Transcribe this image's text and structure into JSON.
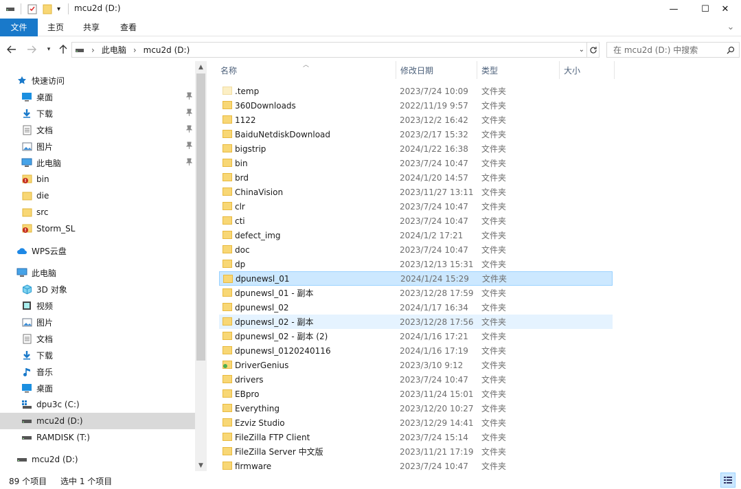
{
  "window": {
    "title": "mcu2d (D:)",
    "minimize": "—",
    "maximize": "☐",
    "close": "✕"
  },
  "ribbon": {
    "tabs": [
      "文件",
      "主页",
      "共享",
      "查看"
    ],
    "expand": "⌄"
  },
  "address": {
    "crumbs": [
      "此电脑",
      "mcu2d (D:)"
    ],
    "separator": "›"
  },
  "search": {
    "placeholder": "在 mcu2d (D:) 中搜索"
  },
  "nav": {
    "quick_access": "快速访问",
    "items": [
      {
        "label": "快速访问",
        "icon": "star-icon",
        "indent": 1,
        "pinned": false,
        "selected": false
      },
      {
        "label": "桌面",
        "icon": "desktop-icon",
        "indent": 2,
        "pinned": true,
        "selected": false
      },
      {
        "label": "下载",
        "icon": "download-icon",
        "indent": 2,
        "pinned": true,
        "selected": false
      },
      {
        "label": "文档",
        "icon": "document-icon",
        "indent": 2,
        "pinned": true,
        "selected": false
      },
      {
        "label": "图片",
        "icon": "pictures-icon",
        "indent": 2,
        "pinned": true,
        "selected": false
      },
      {
        "label": "此电脑",
        "icon": "pc-icon",
        "indent": 2,
        "pinned": true,
        "selected": false
      },
      {
        "label": "bin",
        "icon": "folder-warning-icon",
        "indent": 2,
        "pinned": false,
        "selected": false
      },
      {
        "label": "die",
        "icon": "folder-icon",
        "indent": 2,
        "pinned": false,
        "selected": false
      },
      {
        "label": "src",
        "icon": "folder-icon",
        "indent": 2,
        "pinned": false,
        "selected": false
      },
      {
        "label": "Storm_SL",
        "icon": "folder-warning-icon",
        "indent": 2,
        "pinned": false,
        "selected": false
      },
      {
        "label": "",
        "icon": "",
        "indent": 0,
        "pinned": false,
        "selected": false
      },
      {
        "label": "WPS云盘",
        "icon": "cloud-icon",
        "indent": 1,
        "pinned": false,
        "selected": false
      },
      {
        "label": "",
        "icon": "",
        "indent": 0,
        "pinned": false,
        "selected": false
      },
      {
        "label": "此电脑",
        "icon": "pc-icon",
        "indent": 1,
        "pinned": false,
        "selected": false
      },
      {
        "label": "3D 对象",
        "icon": "cube-icon",
        "indent": 2,
        "pinned": false,
        "selected": false
      },
      {
        "label": "视频",
        "icon": "video-icon",
        "indent": 2,
        "pinned": false,
        "selected": false
      },
      {
        "label": "图片",
        "icon": "pictures-icon",
        "indent": 2,
        "pinned": false,
        "selected": false
      },
      {
        "label": "文档",
        "icon": "document-icon",
        "indent": 2,
        "pinned": false,
        "selected": false
      },
      {
        "label": "下载",
        "icon": "download-icon",
        "indent": 2,
        "pinned": false,
        "selected": false
      },
      {
        "label": "音乐",
        "icon": "music-icon",
        "indent": 2,
        "pinned": false,
        "selected": false
      },
      {
        "label": "桌面",
        "icon": "desktop-icon",
        "indent": 2,
        "pinned": false,
        "selected": false
      },
      {
        "label": "dpu3c (C:)",
        "icon": "system-drive-icon",
        "indent": 2,
        "pinned": false,
        "selected": false
      },
      {
        "label": "mcu2d (D:)",
        "icon": "drive-icon",
        "indent": 2,
        "pinned": false,
        "selected": true
      },
      {
        "label": "RAMDISK (T:)",
        "icon": "drive-icon",
        "indent": 2,
        "pinned": false,
        "selected": false
      },
      {
        "label": "",
        "icon": "",
        "indent": 0,
        "pinned": false,
        "selected": false
      },
      {
        "label": "mcu2d (D:)",
        "icon": "drive-icon",
        "indent": 1,
        "pinned": false,
        "selected": false
      }
    ]
  },
  "columns": {
    "name": "名称",
    "modified": "修改日期",
    "type": "类型",
    "size": "大小"
  },
  "files": [
    {
      "name": ".temp",
      "date": "2023/7/24 10:09",
      "type": "文件夹",
      "state": "",
      "faded": true
    },
    {
      "name": "360Downloads",
      "date": "2022/11/19 9:57",
      "type": "文件夹",
      "state": "",
      "faded": false
    },
    {
      "name": "1122",
      "date": "2023/12/2 16:42",
      "type": "文件夹",
      "state": "",
      "faded": false
    },
    {
      "name": "BaiduNetdiskDownload",
      "date": "2023/2/17 15:32",
      "type": "文件夹",
      "state": "",
      "faded": false
    },
    {
      "name": "bigstrip",
      "date": "2024/1/22 16:38",
      "type": "文件夹",
      "state": "",
      "faded": false
    },
    {
      "name": "bin",
      "date": "2023/7/24 10:47",
      "type": "文件夹",
      "state": "",
      "faded": false
    },
    {
      "name": "brd",
      "date": "2024/1/20 14:57",
      "type": "文件夹",
      "state": "",
      "faded": false
    },
    {
      "name": "ChinaVision",
      "date": "2023/11/27 13:11",
      "type": "文件夹",
      "state": "",
      "faded": false
    },
    {
      "name": "clr",
      "date": "2023/7/24 10:47",
      "type": "文件夹",
      "state": "",
      "faded": false
    },
    {
      "name": "cti",
      "date": "2023/7/24 10:47",
      "type": "文件夹",
      "state": "",
      "faded": false
    },
    {
      "name": "defect_img",
      "date": "2024/1/2 17:21",
      "type": "文件夹",
      "state": "",
      "faded": false
    },
    {
      "name": "doc",
      "date": "2023/7/24 10:47",
      "type": "文件夹",
      "state": "",
      "faded": false
    },
    {
      "name": "dp",
      "date": "2023/12/13 15:31",
      "type": "文件夹",
      "state": "",
      "faded": false
    },
    {
      "name": "dpunewsl_01",
      "date": "2024/1/24 15:29",
      "type": "文件夹",
      "state": "selected",
      "faded": false
    },
    {
      "name": "dpunewsl_01 - 副本",
      "date": "2023/12/28 17:59",
      "type": "文件夹",
      "state": "",
      "faded": false
    },
    {
      "name": "dpunewsl_02",
      "date": "2024/1/17 16:34",
      "type": "文件夹",
      "state": "",
      "faded": false
    },
    {
      "name": "dpunewsl_02 - 副本",
      "date": "2023/12/28 17:56",
      "type": "文件夹",
      "state": "hover",
      "faded": false
    },
    {
      "name": "dpunewsl_02 - 副本 (2)",
      "date": "2024/1/16 17:21",
      "type": "文件夹",
      "state": "",
      "faded": false
    },
    {
      "name": "dpunewsl_0120240116",
      "date": "2024/1/16 17:19",
      "type": "文件夹",
      "state": "",
      "faded": false
    },
    {
      "name": "DriverGenius",
      "date": "2023/3/10 9:12",
      "type": "文件夹",
      "state": "",
      "faded": false
    },
    {
      "name": "drivers",
      "date": "2023/7/24 10:47",
      "type": "文件夹",
      "state": "",
      "faded": false
    },
    {
      "name": "EBpro",
      "date": "2023/11/24 15:01",
      "type": "文件夹",
      "state": "",
      "faded": false
    },
    {
      "name": "Everything",
      "date": "2023/12/20 10:27",
      "type": "文件夹",
      "state": "",
      "faded": false
    },
    {
      "name": "Ezviz Studio",
      "date": "2023/12/29 14:41",
      "type": "文件夹",
      "state": "",
      "faded": false
    },
    {
      "name": "FileZilla FTP Client",
      "date": "2023/7/24 15:14",
      "type": "文件夹",
      "state": "",
      "faded": false
    },
    {
      "name": "FileZilla Server 中文版",
      "date": "2023/11/21 17:19",
      "type": "文件夹",
      "state": "",
      "faded": false
    },
    {
      "name": "firmware",
      "date": "2023/7/24 10:47",
      "type": "文件夹",
      "state": "",
      "faded": false
    }
  ],
  "status": {
    "count": "89 个项目",
    "selected": "选中 1 个项目"
  },
  "colors": {
    "accent": "#1979ca",
    "folder": "#f8d775",
    "folder_dark": "#e8b93f",
    "selected_row": "#cce8ff",
    "hover_row": "#e5f3ff"
  }
}
